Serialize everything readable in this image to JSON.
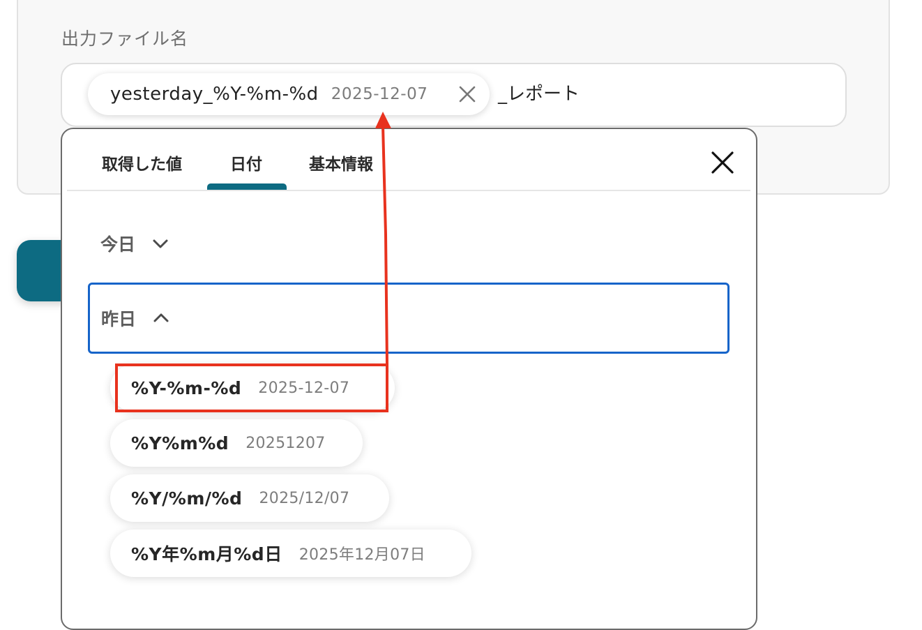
{
  "field": {
    "label": "出力ファイル名",
    "token": {
      "key": "yesterday_%Y-%m-%d",
      "value": "2025-12-07"
    },
    "suffix": "_レポート"
  },
  "picker": {
    "tabs": [
      {
        "label": "取得した値",
        "active": false
      },
      {
        "label": "日付",
        "active": true
      },
      {
        "label": "基本情報",
        "active": false
      }
    ],
    "sections": {
      "today": {
        "label": "今日",
        "expanded": false
      },
      "yesterday": {
        "label": "昨日",
        "expanded": true
      }
    },
    "formats": [
      {
        "code": "%Y-%m-%d",
        "value": "2025-12-07"
      },
      {
        "code": "%Y%m%d",
        "value": "20251207"
      },
      {
        "code": "%Y/%m/%d",
        "value": "2025/12/07"
      },
      {
        "code": "%Y年%m月%d日",
        "value": "2025年12月07日"
      }
    ]
  },
  "colors": {
    "accent": "#0d6b82",
    "focus": "#1664c9",
    "annotation": "#e8321e"
  }
}
